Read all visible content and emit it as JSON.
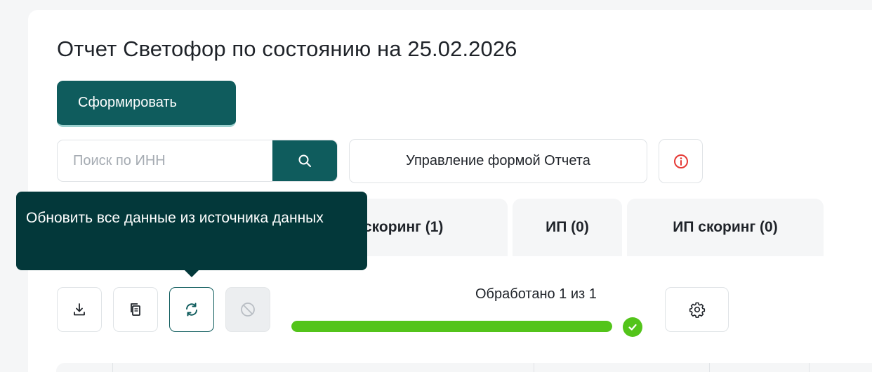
{
  "header": {
    "title": "Отчет Светофор по состоянию на 25.02.2026",
    "generate_label": "Сформировать"
  },
  "search": {
    "placeholder": "Поиск по ИНН",
    "value": "",
    "icon": "search-icon"
  },
  "manage_form_label": "Управление формой Отчета",
  "info_icon": "info-icon",
  "tabs": [
    {
      "label": "скоринг (1)"
    },
    {
      "label": "ИП (0)"
    },
    {
      "label": "ИП скоринг (0)"
    }
  ],
  "toolbar": {
    "icons": [
      "download-icon",
      "copy-icon",
      "refresh-icon",
      "block-icon"
    ],
    "refresh_tooltip": "Обновить все данные из источника данных",
    "settings_icon": "gear-icon"
  },
  "progress": {
    "text": "Обработано 1 из 1",
    "processed": 1,
    "total": 1,
    "fraction": 1.0,
    "status": "complete"
  },
  "colors": {
    "primary": "#0f5c5d",
    "tooltip_bg": "#03383a",
    "success": "#53c41a",
    "danger": "#e53935"
  }
}
